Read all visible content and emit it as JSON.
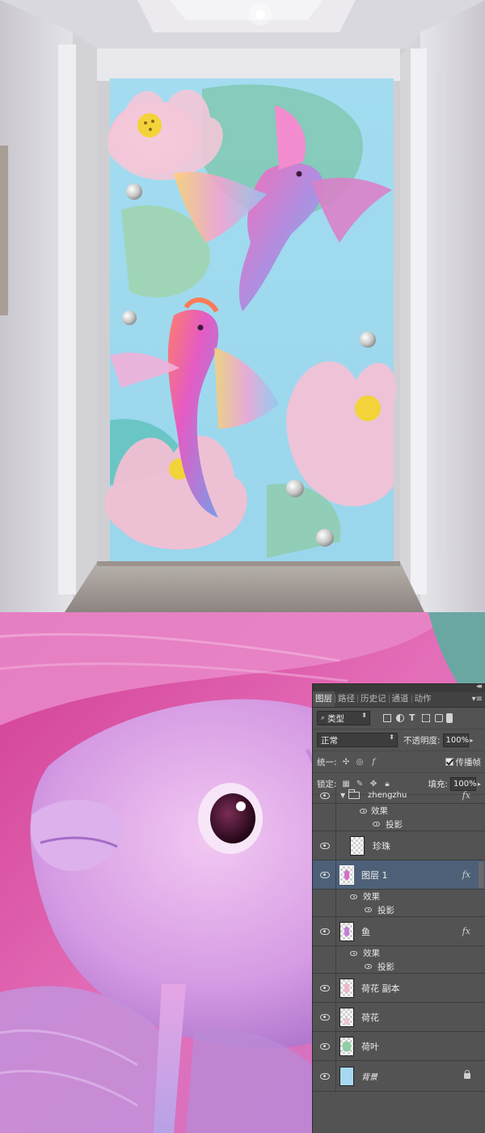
{
  "panel": {
    "tabs": [
      {
        "label": "图层",
        "active": true
      },
      {
        "label": "路径",
        "active": false
      },
      {
        "label": "历史记",
        "active": false
      },
      {
        "label": "通道",
        "active": false
      },
      {
        "label": "动作",
        "active": false
      }
    ],
    "filter_kind": "类型",
    "blend_mode": "正常",
    "opacity_label": "不透明度:",
    "opacity_value": "100%",
    "unify_label": "统一:",
    "propagate_label": "传播帧",
    "lock_label": "锁定:",
    "fill_label": "填充:",
    "fill_value": "100%"
  },
  "layers": [
    {
      "name": "zhengzhu",
      "type": "group",
      "fx": "fx",
      "effects_label": "效果",
      "effect": "投影"
    },
    {
      "name": "珍珠",
      "type": "layer"
    },
    {
      "name": "图层 1",
      "type": "layer",
      "selected": true,
      "fx": "fx",
      "effects_label": "效果",
      "effect": "投影"
    },
    {
      "name": "鱼",
      "type": "layer",
      "fx": "fx",
      "effects_label": "效果",
      "effect": "投影"
    },
    {
      "name": "荷花 副本",
      "type": "layer"
    },
    {
      "name": "荷花",
      "type": "layer"
    },
    {
      "name": "荷叶",
      "type": "layer"
    },
    {
      "name": "背景",
      "type": "background",
      "locked": true
    }
  ],
  "colors": {
    "panel_bg": "#535353",
    "selected_layer": "#4d6078",
    "mural_sky": "#a9def0",
    "fish_pink": "#e06ac0"
  },
  "icons": [
    "eye-icon",
    "folder-icon",
    "lock-icon",
    "fx-icon",
    "panel-menu-icon",
    "search-icon",
    "link-icon",
    "brush-icon",
    "move-icon"
  ]
}
